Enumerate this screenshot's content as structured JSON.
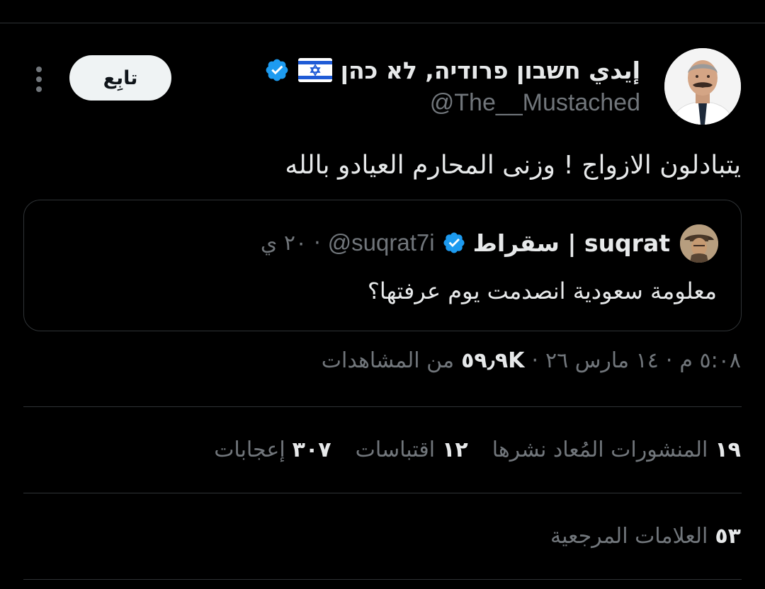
{
  "author": {
    "display_name": "إيدي חשבון פרודיה, לא כהן",
    "handle": "@The__Mustached",
    "flag_icon": "israel-flag-icon",
    "verified_icon": "verified-badge-icon",
    "verified_color": "#1d9bf0"
  },
  "actions": {
    "follow_label": "تابِع",
    "more_icon": "more-vertical-icon"
  },
  "tweet": {
    "text": "يتبادلون الازواج ! وزنى المحارم العيادو بالله"
  },
  "quote": {
    "display_name": "سقراط | suqrat",
    "handle": "@suqrat7i",
    "separator": "·",
    "time": "٢٠ ي",
    "text": "معلومة سعودية انصدمت يوم عرفتها؟"
  },
  "meta": {
    "time": "٥:٠٨ م",
    "dot1": "·",
    "date": "١٤ مارس ٢٦",
    "dot2": "·",
    "views_count": "٥٩٫٩K",
    "views_label": "من المشاهدات"
  },
  "stats": {
    "reposts_count": "١٩",
    "reposts_label": "المنشورات المُعاد نشرها",
    "quotes_count": "١٢",
    "quotes_label": "اقتباسات",
    "likes_count": "٣٠٧",
    "likes_label": "إعجابات",
    "bookmarks_count": "٥٣",
    "bookmarks_label": "العلامات المرجعية"
  },
  "colors": {
    "background": "#000000",
    "primary_text": "#e7e9ea",
    "secondary_text": "#71767b",
    "border": "#2f3336",
    "follow_button_bg": "#eff3f4"
  }
}
